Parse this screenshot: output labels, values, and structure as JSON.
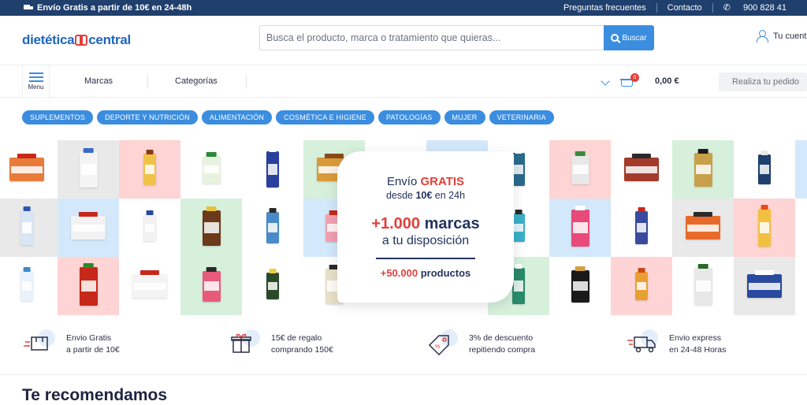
{
  "topbar": {
    "promo": "Envío Gratis a partir de 10€ en 24-48h",
    "links": [
      "Preguntas frecuentes",
      "Contacto",
      "900 828 41"
    ]
  },
  "header": {
    "logo_left": "dietética",
    "logo_right": "central",
    "search_placeholder": "Busca el producto, marca o tratamiento que quieras...",
    "search_button": "Buscar",
    "account": "Tu cuent"
  },
  "nav": {
    "menu_label": "Menu",
    "brands": "Marcas",
    "categories": "Categorías",
    "cart_count": "0",
    "cart_total": "0,00 €",
    "order_button": "Realiza tu pedido"
  },
  "categories": [
    "SUPLEMENTOS",
    "DEPORTE Y NUTRICIÓN",
    "ALIMENTACIÓN",
    "COSMÉTICA E HIGIENE",
    "PATOLOGÍAS",
    "MUJER",
    "VETERINARIA"
  ],
  "banner": {
    "line1_a": "Envío ",
    "line1_b": "GRATIS",
    "line2_a": "desde ",
    "line2_b": "10€",
    "line2_c": " en 24h",
    "line3_a": "+1.000",
    "line3_b": " marcas",
    "line4": "a tu disposición",
    "line5_a": "+50.000",
    "line5_b": " productos"
  },
  "benefits": [
    {
      "title": "Envio Gratis",
      "subtitle": "a partir de 10€"
    },
    {
      "title": "15€ de regalo",
      "subtitle": "comprando 150€"
    },
    {
      "title": "3% de descuento",
      "subtitle": "repitiendo compra"
    },
    {
      "title": "Envio express",
      "subtitle": "en 24-48 Horas"
    }
  ],
  "section_title": "Te recomendamos",
  "colors": {
    "topbar": "#1f3f6d",
    "accent": "#3b8de0",
    "brand_red": "#e2403b",
    "navy": "#23345e"
  }
}
